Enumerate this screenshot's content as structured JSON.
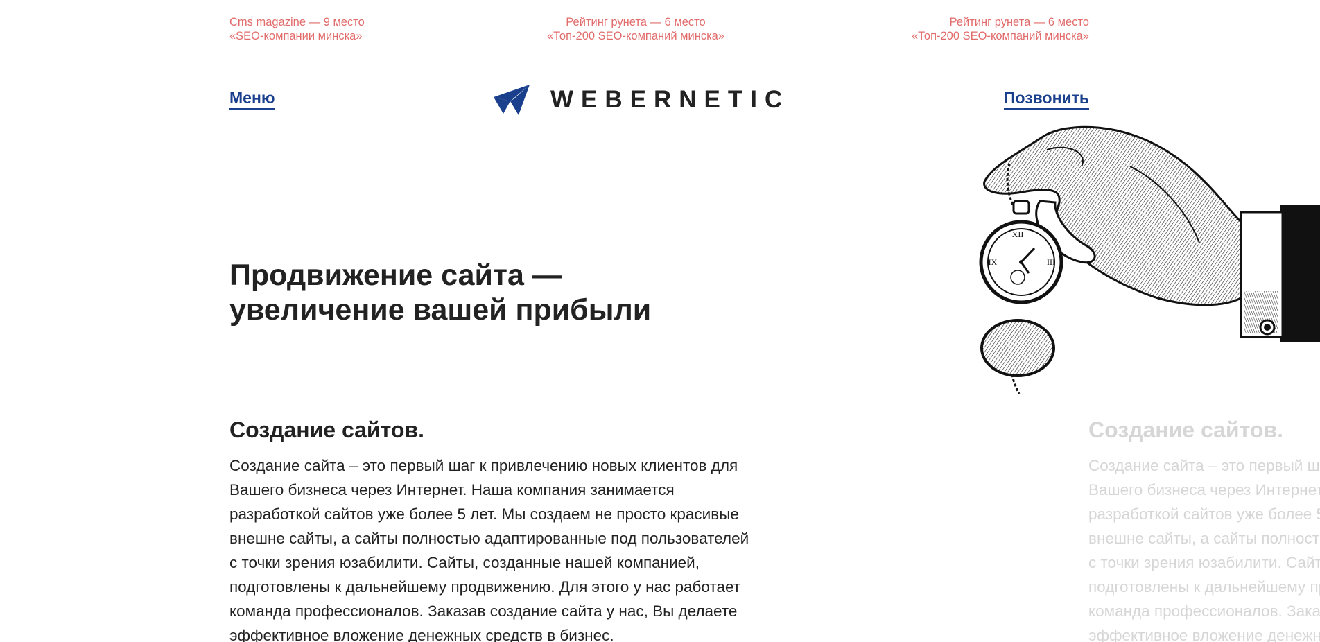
{
  "ratings": [
    {
      "line1": "Cms magazine — 9 место",
      "line2": "«SEO-компании минска»"
    },
    {
      "line1": "Рейтинг рунета — 6 место",
      "line2": "«Топ-200 SEO-компаний минска»"
    },
    {
      "line1": "Рейтинг рунета — 6 место",
      "line2": "«Топ-200 SEO-компаний минска»"
    }
  ],
  "nav": {
    "menu_label": "Меню",
    "call_label": "Позвонить"
  },
  "logo": {
    "text": "WEBERNETIC",
    "mark_icon": "paper-plane-logo-icon"
  },
  "hero": {
    "title_line1": "Продвижение сайта —",
    "title_line2": "увеличение вашей прибыли"
  },
  "section": {
    "title": "Создание сайтов.",
    "text": "Создание сайта – это первый шаг к привлечению новых клиентов для Вашего бизнеса через Интернет. Наша компания занимается разработкой сайтов уже более 5 лет. Мы создаем не просто красивые внешне сайты, а сайты полностью адаптированные под пользователей с точки зрения юзабилити. Сайты, созданные нашей компанией, подготовлены к дальнейшему продвижению. Для этого у нас работает команда профессионалов. Заказав создание сайта у нас, Вы делаете эффективное вложение денежных средств в бизнес."
  },
  "illustration": {
    "icon": "hand-holding-pocket-watch-icon"
  },
  "colors": {
    "accent": "#1a3f8c",
    "rating": "#e26b6b",
    "text": "#222222",
    "ghost": "#d6d6d6"
  }
}
